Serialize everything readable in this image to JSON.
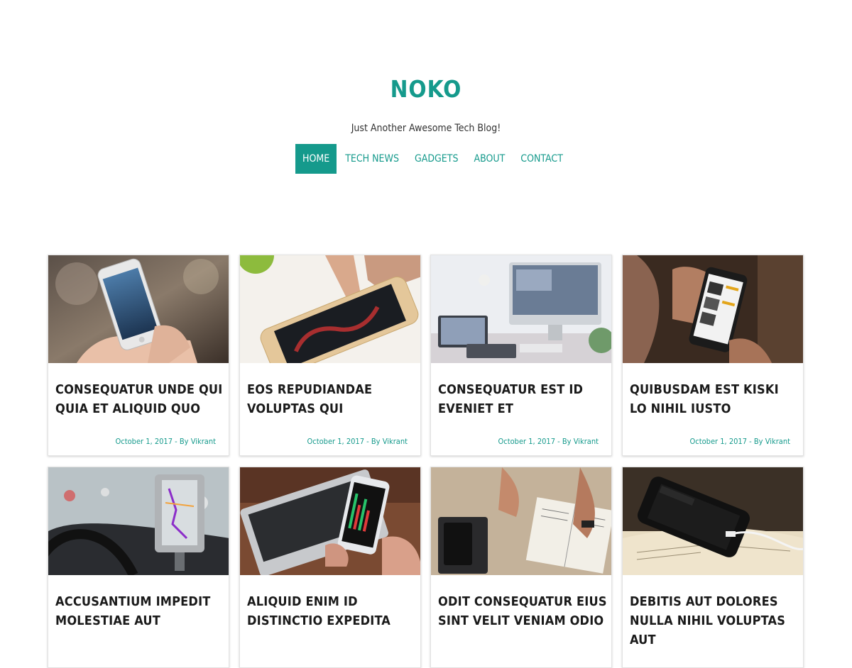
{
  "site": {
    "title": "NOKO",
    "tagline": "Just Another Awesome Tech Blog!",
    "accent_color": "#159a8c"
  },
  "nav": {
    "items": [
      {
        "label": "HOME",
        "active": true
      },
      {
        "label": "TECH NEWS",
        "active": false
      },
      {
        "label": "GADGETS",
        "active": false
      },
      {
        "label": "ABOUT",
        "active": false
      },
      {
        "label": "CONTACT",
        "active": false
      }
    ]
  },
  "posts": [
    {
      "title": "CONSEQUATUR UNDE QUI QUIA ET ALIQUID QUO",
      "date": "October 1, 2017",
      "by": "By",
      "author": "Vikrant",
      "image": "hand-holding-iphone-photo"
    },
    {
      "title": "EOS REPUDIANDAE VOLUPTAS QUI",
      "date": "October 1, 2017",
      "by": "By",
      "author": "Vikrant",
      "image": "finger-touching-phone-photo"
    },
    {
      "title": "CONSEQUATUR EST ID EVENIET ET",
      "date": "October 1, 2017",
      "by": "By",
      "author": "Vikrant",
      "image": "imac-desk-setup-photo"
    },
    {
      "title": "QUIBUSDAM EST KISKI LO NIHIL IUSTO",
      "date": "October 1, 2017",
      "by": "By",
      "author": "Vikrant",
      "image": "phone-shopping-app-photo"
    },
    {
      "title": "ACCUSANTIUM IMPEDIT MOLESTIAE AUT",
      "date": "",
      "by": "",
      "author": "",
      "image": "car-phone-navigation-photo"
    },
    {
      "title": "ALIQUID ENIM ID DISTINCTIO EXPEDITA",
      "date": "",
      "by": "",
      "author": "",
      "image": "laptop-phone-chart-photo"
    },
    {
      "title": "ODIT CONSEQUATUR EIUS SINT VELIT VENIAM ODIO",
      "date": "",
      "by": "",
      "author": "",
      "image": "hands-book-desk-photo"
    },
    {
      "title": "DEBITIS AUT DOLORES NULLA NIHIL VOLUPTAS AUT",
      "date": "",
      "by": "",
      "author": "",
      "image": "phone-on-bible-photo"
    }
  ]
}
